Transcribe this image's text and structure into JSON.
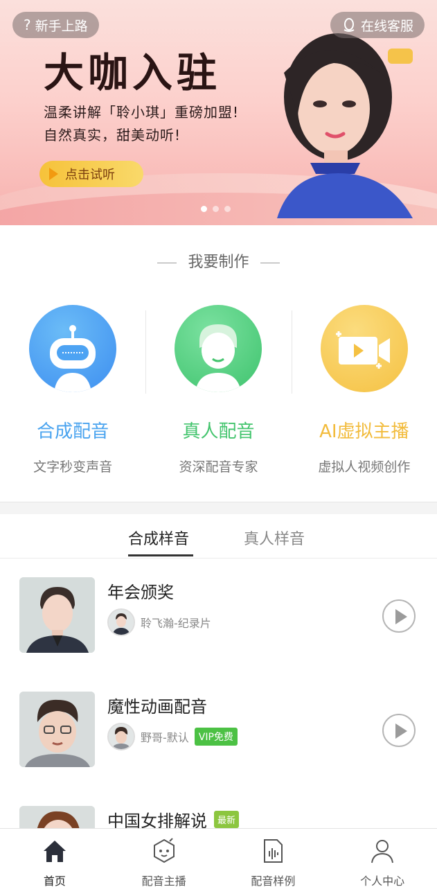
{
  "banner": {
    "help_label": "新手上路",
    "service_label": "在线客服",
    "title": "大咖入驻",
    "line1": "温柔讲解「聆小琪」重磅加盟!",
    "line2": "自然真实，甜美动听!",
    "listen_button": "点击试听",
    "carousel_total": 3,
    "carousel_active": 1
  },
  "make": {
    "heading": "我要制作",
    "items": [
      {
        "title": "合成配音",
        "subtitle": "文字秒变声音",
        "icon": "robot-icon",
        "color": "#49a3ef"
      },
      {
        "title": "真人配音",
        "subtitle": "资深配音专家",
        "icon": "person-icon",
        "color": "#43c46d"
      },
      {
        "title": "AI虚拟主播",
        "subtitle": "虚拟人视频创作",
        "icon": "video-camera-icon",
        "color": "#f2bb3b"
      }
    ]
  },
  "tabs": {
    "items": [
      "合成样音",
      "真人样音"
    ],
    "active": 0
  },
  "samples": [
    {
      "title": "年会颁奖",
      "voice": "聆飞瀚-纪录片",
      "badge": "",
      "title_badge": ""
    },
    {
      "title": "魔性动画配音",
      "voice": "野哥-默认",
      "badge": "VIP免费",
      "title_badge": ""
    },
    {
      "title": "中国女排解说",
      "voice": "",
      "badge": "",
      "title_badge": "最新"
    }
  ],
  "nav": {
    "items": [
      {
        "label": "首页",
        "icon": "home-icon"
      },
      {
        "label": "配音主播",
        "icon": "anchor-bot-icon"
      },
      {
        "label": "配音样例",
        "icon": "audio-file-icon"
      },
      {
        "label": "个人中心",
        "icon": "user-icon"
      }
    ],
    "active": 0
  }
}
